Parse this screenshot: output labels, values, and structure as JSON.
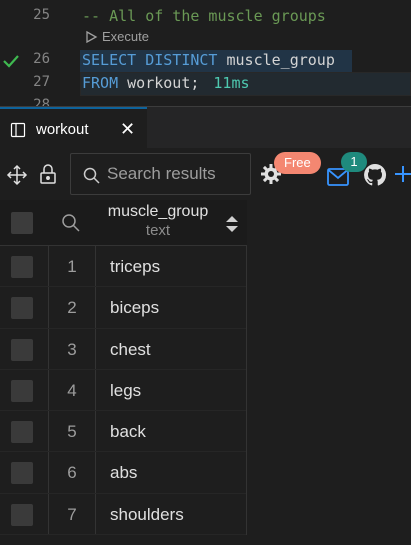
{
  "editor": {
    "lines": [
      {
        "number": "25",
        "comment": "-- All of the muscle groups"
      },
      {
        "number": "26",
        "kw1": "SELECT DISTINCT",
        "ident": "muscle_group"
      },
      {
        "number": "27",
        "kw1": "FROM",
        "ident": "workout;",
        "timing": "11ms"
      },
      {
        "number": "28"
      }
    ],
    "codelens_label": "Execute"
  },
  "panel": {
    "tab_label": "workout",
    "close_glyph": "✕"
  },
  "toolbar": {
    "search_placeholder": "Search results",
    "free_badge": "Free",
    "notification_count": "1"
  },
  "grid": {
    "column": {
      "name": "muscle_group",
      "type": "text"
    },
    "rows": [
      {
        "num": "1",
        "value": "triceps"
      },
      {
        "num": "2",
        "value": "biceps"
      },
      {
        "num": "3",
        "value": "chest"
      },
      {
        "num": "4",
        "value": "legs"
      },
      {
        "num": "5",
        "value": "back"
      },
      {
        "num": "6",
        "value": "abs"
      },
      {
        "num": "7",
        "value": "shoulders"
      }
    ]
  },
  "colors": {
    "accent": "#0e639c",
    "comment": "#6a9955",
    "keyword": "#569cd6",
    "timing": "#4ec9b0",
    "free_badge": "#f48771",
    "count_badge": "#1f8a7d",
    "success_check": "#3fb950"
  },
  "icons": {
    "codelens": "play-outline-icon",
    "status": "checkmark-icon",
    "tab": "split-panel-icon",
    "move": "move-arrows-icon",
    "lock": "lock-icon",
    "search": "search-icon",
    "settings": "gear-icon",
    "mail": "mail-icon",
    "github": "github-icon",
    "add": "plus-icon"
  }
}
